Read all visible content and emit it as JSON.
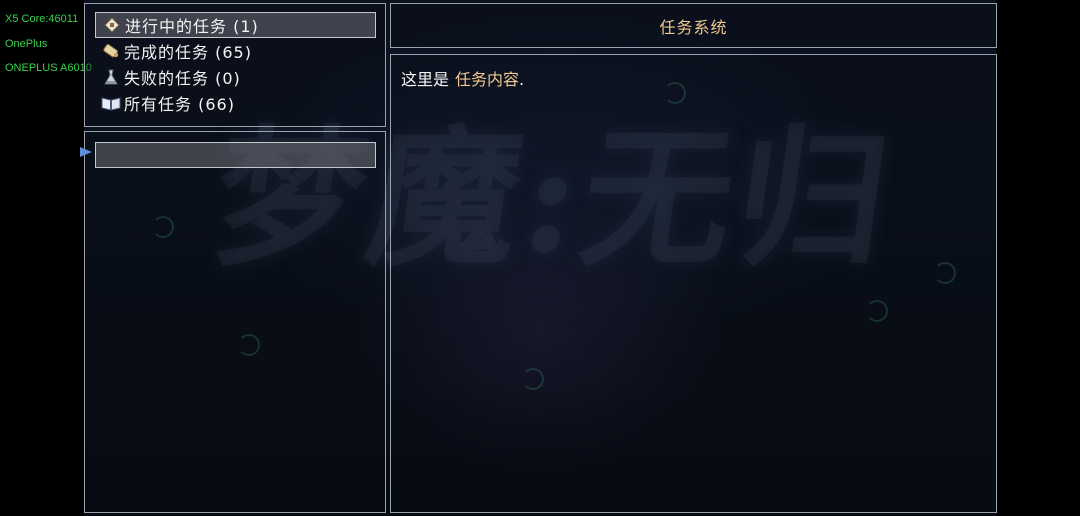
{
  "device_info": {
    "line1": "X5 Core:46011",
    "line2": "OnePlus",
    "line3": "ONEPLUS A6010"
  },
  "background": {
    "watermark_text": "梦魔:无归"
  },
  "categories": [
    {
      "label": "进行中的任务 (1)",
      "icon": "diamond-scroll-icon",
      "selected": true
    },
    {
      "label": "完成的任务 (65)",
      "icon": "scroll-icon",
      "selected": false
    },
    {
      "label": "失败的任务 (0)",
      "icon": "flask-icon",
      "selected": false
    },
    {
      "label": "所有任务 (66)",
      "icon": "book-icon",
      "selected": false
    }
  ],
  "task_list": {
    "selected_task_label": ""
  },
  "title_panel": {
    "title": "任务系统"
  },
  "content": {
    "prefix": "这里是",
    "highlight": "任务内容",
    "suffix": "."
  },
  "colors": {
    "device_info": "#38d24a",
    "highlight": "#f0c890",
    "panel_border": "#9aa2ab",
    "selection": "#6e7076"
  }
}
